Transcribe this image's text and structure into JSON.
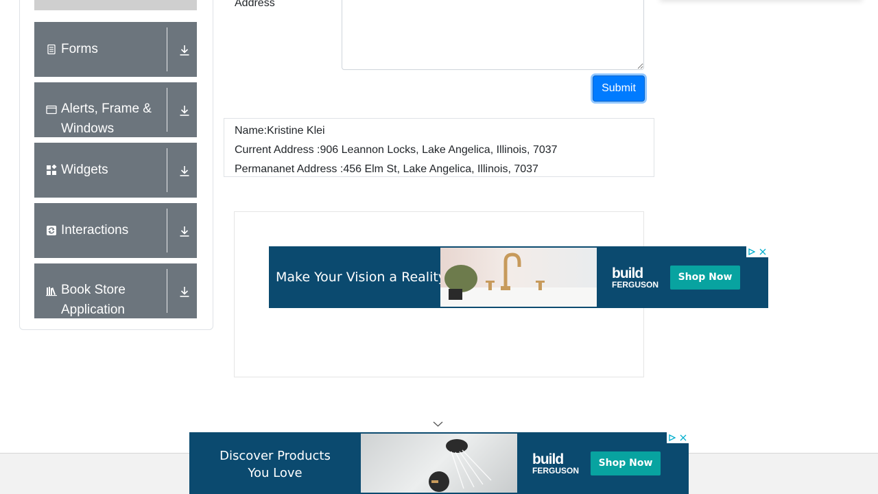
{
  "sidebar": {
    "groups": [
      {
        "label": "Forms",
        "icon": "document-icon"
      },
      {
        "label": "Alerts, Frame & Windows",
        "icon": "window-icon"
      },
      {
        "label": "Widgets",
        "icon": "widgets-icon"
      },
      {
        "label": "Interactions",
        "icon": "interaction-icon"
      },
      {
        "label": "Book Store Application",
        "icon": "books-icon"
      }
    ]
  },
  "form": {
    "address_label": "Address",
    "current_address_value": "",
    "submit_label": "Submit"
  },
  "output": {
    "name": "Name:Kristine Klei",
    "current_address": "Current Address :906 Leannon Locks, Lake Angelica, Illinois, 7037",
    "permanent_address": "Permananet Address :456 Elm St, Lake Angelica, Illinois, 7037"
  },
  "ads": {
    "banner_top": {
      "headline": "Make Your Vision a Reality",
      "brand_top": "build",
      "brand_bottom": "FERGUSON",
      "cta": "Shop Now"
    },
    "banner_bottom": {
      "headline": "Discover Products You Love",
      "brand_top": "build",
      "brand_bottom": "FERGUSON",
      "cta": "Shop Now"
    }
  },
  "colors": {
    "sidebar_group_bg": "#6c757d",
    "primary": "#007bff",
    "ad_bg": "#0b4a6f",
    "ad_cta": "#08a3a0"
  }
}
